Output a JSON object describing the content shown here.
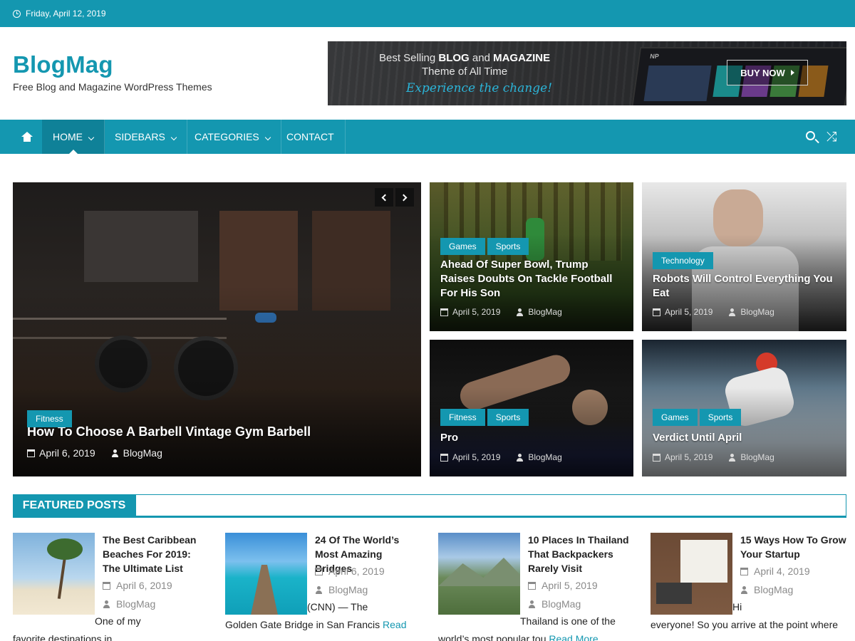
{
  "topbar": {
    "date": "Friday, April 12, 2019"
  },
  "site": {
    "title": "BlogMag",
    "description": "Free Blog and Magazine WordPress Themes"
  },
  "banner": {
    "line1_prefix": "Best Selling ",
    "line1_bold1": "BLOG",
    "line1_mid": " and ",
    "line1_bold2": "MAGAZINE",
    "line2": "Theme of All Time",
    "line3": "Experience the change!",
    "button": "BUY NOW",
    "screen_logo": "NP"
  },
  "nav": {
    "items": [
      {
        "label": "HOME",
        "dropdown": true,
        "active": true
      },
      {
        "label": "SIDEBARS",
        "dropdown": true
      },
      {
        "label": "CATEGORIES",
        "dropdown": true
      },
      {
        "label": "CONTACT",
        "dropdown": false
      }
    ],
    "icons": [
      "home-icon",
      "search-icon",
      "shuffle-icon"
    ]
  },
  "slider": {
    "tags": [
      "Fitness"
    ],
    "title": "How To Choose A Barbell Vintage Gym Barbell",
    "date": "April 6, 2019",
    "author": "BlogMag"
  },
  "grid": [
    {
      "tags": [
        "Games",
        "Sports"
      ],
      "title": "Ahead Of Super Bowl, Trump Raises Doubts On Tackle Football For His Son",
      "date": "April 5, 2019",
      "author": "BlogMag"
    },
    {
      "tags": [
        "Technology"
      ],
      "title": "Robots Will Control Everything You Eat",
      "date": "April 5, 2019",
      "author": "BlogMag"
    },
    {
      "tags": [
        "Fitness",
        "Sports"
      ],
      "title": "Pro",
      "date": "April 5, 2019",
      "author": "BlogMag"
    },
    {
      "tags": [
        "Games",
        "Sports"
      ],
      "title": "Verdict Until April",
      "date": "April 5, 2019",
      "author": "BlogMag"
    }
  ],
  "featured": {
    "heading": "FEATURED POSTS",
    "posts": [
      {
        "title": "The Best Caribbean Beaches For 2019: The Ultimate List",
        "date": "April 6, 2019",
        "author": "BlogMag",
        "excerpt_a": "One of my",
        "excerpt_b": "favorite destinations in",
        "read_more": ""
      },
      {
        "title": "24 Of The World’s Most Amazing Bridges",
        "date": "April 6, 2019",
        "author": "BlogMag",
        "excerpt_a": "(CNN) — The",
        "excerpt_b": "Golden Gate Bridge in San Francis",
        "read_more": "Read"
      },
      {
        "title": "10 Places In Thailand That Backpackers Rarely Visit",
        "date": "April 5, 2019",
        "author": "BlogMag",
        "excerpt_a": "Thailand is one of the",
        "excerpt_b": "world’s most popular tou",
        "read_more": "Read More"
      },
      {
        "title": "15 Ways How To Grow Your Startup",
        "date": "April 4, 2019",
        "author": "BlogMag",
        "excerpt_a": "Hi",
        "excerpt_b": "everyone! So you arrive at the point where",
        "read_more": ""
      }
    ]
  },
  "colors": {
    "accent": "#1497b0",
    "accent_dark": "#0f8198",
    "text": "#333333",
    "meta": "#8a8a8a"
  }
}
